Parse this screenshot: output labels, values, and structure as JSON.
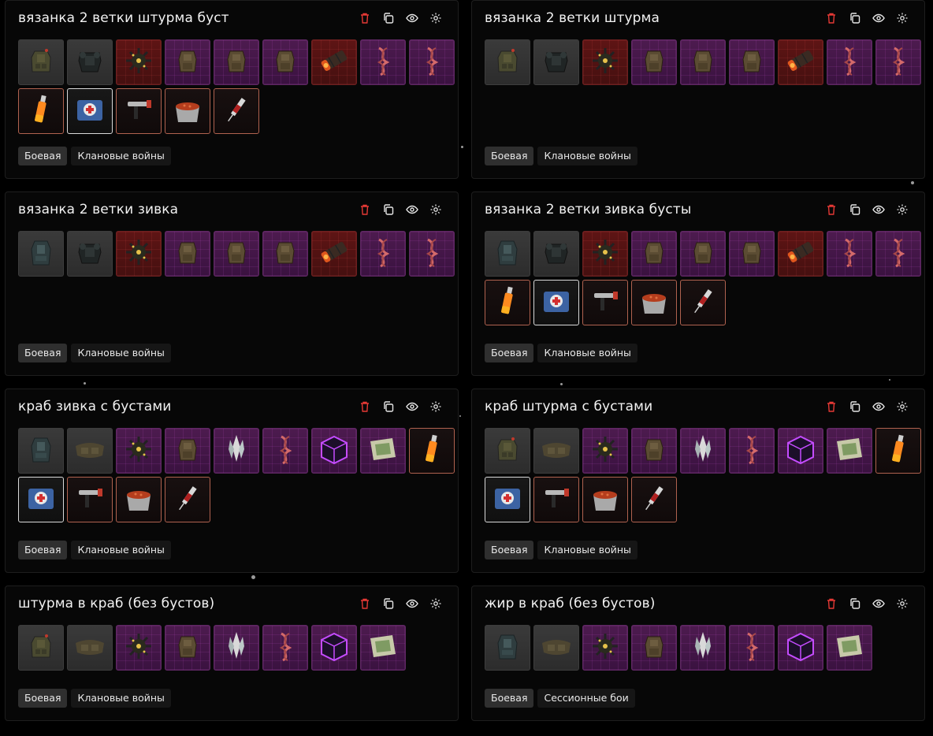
{
  "colors": {
    "accent_delete": "#e53935",
    "icon": "#e6e6e6",
    "tag_active_bg": "#2f2f2f",
    "tag_bg": "#161616"
  },
  "cards": [
    {
      "title": "вязанка 2 ветки штурма буст",
      "items": [
        {
          "icon": "assault-armor-icon",
          "rarity": "gray"
        },
        {
          "icon": "heavy-armor-icon",
          "rarity": "gray"
        },
        {
          "icon": "spiked-mine-icon",
          "rarity": "red"
        },
        {
          "icon": "backpack-icon",
          "rarity": "purple"
        },
        {
          "icon": "backpack-icon",
          "rarity": "purple"
        },
        {
          "icon": "backpack-icon",
          "rarity": "purple"
        },
        {
          "icon": "dynamite-bundle-icon",
          "rarity": "red"
        },
        {
          "icon": "red-dna-icon",
          "rarity": "purple"
        },
        {
          "icon": "red-dna-icon",
          "rarity": "purple"
        },
        {
          "icon": "orange-vial-icon",
          "rarity": "brown"
        },
        {
          "icon": "medkit-icon",
          "rarity": "bluebox"
        },
        {
          "icon": "injector-gun-icon",
          "rarity": "brown"
        },
        {
          "icon": "stew-pot-icon",
          "rarity": "brown"
        },
        {
          "icon": "syringe-icon",
          "rarity": "brown"
        }
      ],
      "tags": [
        "Боевая",
        "Клановые войны"
      ]
    },
    {
      "title": "вязанка 2 ветки штурма",
      "items": [
        {
          "icon": "assault-armor-icon",
          "rarity": "gray"
        },
        {
          "icon": "heavy-armor-icon",
          "rarity": "gray"
        },
        {
          "icon": "spiked-mine-icon",
          "rarity": "red"
        },
        {
          "icon": "backpack-icon",
          "rarity": "purple"
        },
        {
          "icon": "backpack-icon",
          "rarity": "purple"
        },
        {
          "icon": "backpack-icon",
          "rarity": "purple"
        },
        {
          "icon": "dynamite-bundle-icon",
          "rarity": "red"
        },
        {
          "icon": "red-dna-icon",
          "rarity": "purple"
        },
        {
          "icon": "red-dna-icon",
          "rarity": "purple"
        }
      ],
      "tags": [
        "Боевая",
        "Клановые войны"
      ]
    },
    {
      "title": "вязанка 2 ветки зивка",
      "items": [
        {
          "icon": "teal-armor-icon",
          "rarity": "gray"
        },
        {
          "icon": "heavy-armor-icon",
          "rarity": "gray"
        },
        {
          "icon": "spiked-mine-icon",
          "rarity": "red"
        },
        {
          "icon": "backpack-icon",
          "rarity": "purple"
        },
        {
          "icon": "backpack-icon",
          "rarity": "purple"
        },
        {
          "icon": "backpack-icon",
          "rarity": "purple"
        },
        {
          "icon": "dynamite-bundle-icon",
          "rarity": "red"
        },
        {
          "icon": "red-dna-icon",
          "rarity": "purple"
        },
        {
          "icon": "red-dna-icon",
          "rarity": "purple"
        }
      ],
      "tags": [
        "Боевая",
        "Клановые войны"
      ]
    },
    {
      "title": "вязанка 2 ветки зивка бусты",
      "items": [
        {
          "icon": "teal-armor-icon",
          "rarity": "gray"
        },
        {
          "icon": "heavy-armor-icon",
          "rarity": "gray"
        },
        {
          "icon": "spiked-mine-icon",
          "rarity": "red"
        },
        {
          "icon": "backpack-icon",
          "rarity": "purple"
        },
        {
          "icon": "backpack-icon",
          "rarity": "purple"
        },
        {
          "icon": "backpack-icon",
          "rarity": "purple"
        },
        {
          "icon": "dynamite-bundle-icon",
          "rarity": "red"
        },
        {
          "icon": "red-dna-icon",
          "rarity": "purple"
        },
        {
          "icon": "red-dna-icon",
          "rarity": "purple"
        },
        {
          "icon": "orange-vial-icon",
          "rarity": "brown"
        },
        {
          "icon": "medkit-icon",
          "rarity": "bluebox"
        },
        {
          "icon": "injector-gun-icon",
          "rarity": "brown"
        },
        {
          "icon": "stew-pot-icon",
          "rarity": "brown"
        },
        {
          "icon": "syringe-icon",
          "rarity": "brown"
        }
      ],
      "tags": [
        "Боевая",
        "Клановые войны"
      ]
    },
    {
      "title": "краб зивка с бустами",
      "items": [
        {
          "icon": "teal-armor-icon",
          "rarity": "gray"
        },
        {
          "icon": "belt-pouch-icon",
          "rarity": "gray"
        },
        {
          "icon": "spiked-mine-icon",
          "rarity": "purple"
        },
        {
          "icon": "backpack-icon",
          "rarity": "purple"
        },
        {
          "icon": "crystal-icon",
          "rarity": "purple"
        },
        {
          "icon": "red-dna-icon",
          "rarity": "purple"
        },
        {
          "icon": "cube-icon",
          "rarity": "purple"
        },
        {
          "icon": "map-icon",
          "rarity": "purple"
        },
        {
          "icon": "orange-vial-icon",
          "rarity": "brown"
        },
        {
          "icon": "medkit-icon",
          "rarity": "bluebox"
        },
        {
          "icon": "injector-gun-icon",
          "rarity": "brown"
        },
        {
          "icon": "stew-pot-icon",
          "rarity": "brown"
        },
        {
          "icon": "syringe-icon",
          "rarity": "brown"
        }
      ],
      "tags": [
        "Боевая",
        "Клановые войны"
      ]
    },
    {
      "title": "краб штурма с бустами",
      "items": [
        {
          "icon": "assault-armor-icon",
          "rarity": "gray"
        },
        {
          "icon": "belt-pouch-icon",
          "rarity": "gray"
        },
        {
          "icon": "spiked-mine-icon",
          "rarity": "purple"
        },
        {
          "icon": "backpack-icon",
          "rarity": "purple"
        },
        {
          "icon": "crystal-icon",
          "rarity": "purple"
        },
        {
          "icon": "red-dna-icon",
          "rarity": "purple"
        },
        {
          "icon": "cube-icon",
          "rarity": "purple"
        },
        {
          "icon": "map-icon",
          "rarity": "purple"
        },
        {
          "icon": "orange-vial-icon",
          "rarity": "brown"
        },
        {
          "icon": "medkit-icon",
          "rarity": "bluebox"
        },
        {
          "icon": "injector-gun-icon",
          "rarity": "brown"
        },
        {
          "icon": "stew-pot-icon",
          "rarity": "brown"
        },
        {
          "icon": "syringe-icon",
          "rarity": "brown"
        }
      ],
      "tags": [
        "Боевая",
        "Клановые войны"
      ]
    },
    {
      "title": "штурма в краб (без бустов)",
      "items": [
        {
          "icon": "assault-armor-icon",
          "rarity": "gray"
        },
        {
          "icon": "belt-pouch-icon",
          "rarity": "gray"
        },
        {
          "icon": "spiked-mine-icon",
          "rarity": "purple"
        },
        {
          "icon": "backpack-icon",
          "rarity": "purple"
        },
        {
          "icon": "crystal-icon",
          "rarity": "purple"
        },
        {
          "icon": "red-dna-icon",
          "rarity": "purple"
        },
        {
          "icon": "cube-icon",
          "rarity": "purple"
        },
        {
          "icon": "map-icon",
          "rarity": "purple"
        }
      ],
      "tags": [
        "Боевая",
        "Клановые войны"
      ]
    },
    {
      "title": "жир в краб (без бустов)",
      "items": [
        {
          "icon": "teal-armor-icon",
          "rarity": "gray"
        },
        {
          "icon": "belt-pouch-icon",
          "rarity": "gray"
        },
        {
          "icon": "spiked-mine-icon",
          "rarity": "purple"
        },
        {
          "icon": "backpack-icon",
          "rarity": "purple"
        },
        {
          "icon": "crystal-icon",
          "rarity": "purple"
        },
        {
          "icon": "red-dna-icon",
          "rarity": "purple"
        },
        {
          "icon": "cube-icon",
          "rarity": "purple"
        },
        {
          "icon": "map-icon",
          "rarity": "purple"
        }
      ],
      "tags": [
        "Боевая",
        "Сессионные бои"
      ]
    }
  ]
}
